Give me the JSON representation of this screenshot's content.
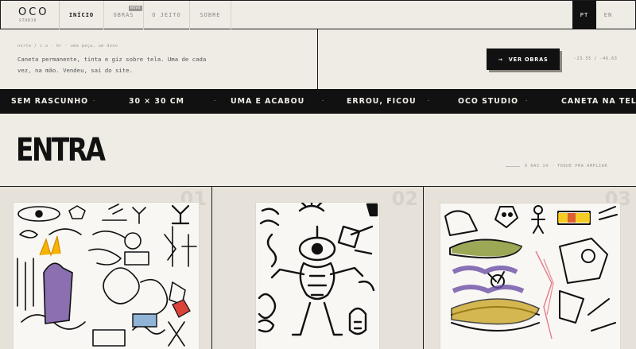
{
  "brand": {
    "name": "OCO",
    "sub": "STUDIO"
  },
  "nav": {
    "items": [
      {
        "label": "INÍCIO",
        "active": true
      },
      {
        "label": "OBRAS",
        "badge": "NOVO"
      },
      {
        "label": "O JEITO"
      },
      {
        "label": "SOBRE"
      }
    ],
    "lang": [
      "PT",
      "EN"
    ]
  },
  "info": {
    "breadcrumb": "norte / c.o · br · uma peça, um dono",
    "description": "Caneta permanente, tinta e giz sobre tela. Uma de cada vez, na mão. Vendeu, saí do site.",
    "cta": "VER OBRAS",
    "cta_icon": "arrow-right-icon",
    "coords": "-23.55 / -46.63"
  },
  "ticker": [
    "SEM RASCUNHO",
    "30 × 30 CM",
    "UMA E ACABOU",
    "ERROU, FICOU",
    "OCO STUDIO",
    "CANETA NA TELA"
  ],
  "section": {
    "title": "ENTRA",
    "meta": "6 DAS 14 · TOQUE PRA AMPLIAR"
  },
  "cards": [
    {
      "num": "01"
    },
    {
      "num": "02"
    },
    {
      "num": "03"
    }
  ],
  "colors": {
    "ink": "#111111",
    "paper": "#efece5",
    "card": "#e6e2da"
  }
}
